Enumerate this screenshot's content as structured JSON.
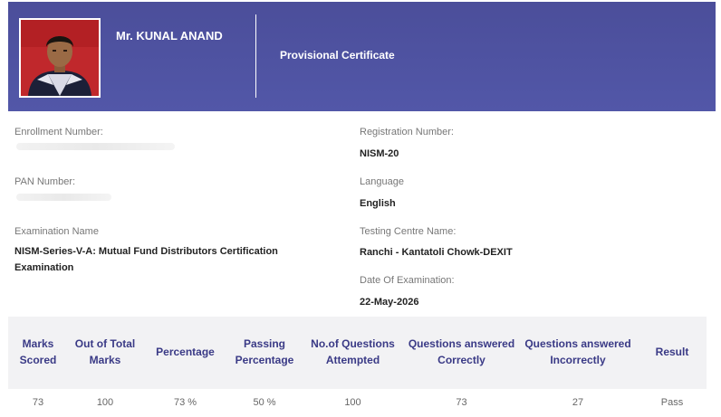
{
  "header": {
    "holder_name": "Mr. KUNAL ANAND",
    "certificate_type": "Provisional Certificate",
    "colors": {
      "band": "#5055a3",
      "table_header_text": "#3a3a86"
    }
  },
  "photo": {
    "icon": "candidate-photo"
  },
  "details": {
    "enrollment_label": "Enrollment Number:",
    "registration_label": "Registration Number:",
    "registration_value": "NISM-20",
    "pan_label": "PAN Number:",
    "language_label": "Language",
    "language_value": "English",
    "exam_name_label": "Examination Name",
    "exam_name_value": "NISM-Series-V-A: Mutual Fund Distributors Certification Examination",
    "centre_label": "Testing Centre Name:",
    "centre_value": "Ranchi - Kantatoli Chowk-DEXIT",
    "date_label": "Date Of Examination:",
    "date_value": "22-May-2026"
  },
  "results": {
    "headers": [
      "Marks Scored",
      "Out of Total Marks",
      "Percentage",
      "Passing Percentage",
      "No.of Questions Attempted",
      "Questions answered Correctly",
      "Questions answered Incorrectly",
      "Result"
    ],
    "row": [
      "73",
      "100",
      "73 %",
      "50 %",
      "100",
      "73",
      "27",
      "Pass"
    ]
  }
}
